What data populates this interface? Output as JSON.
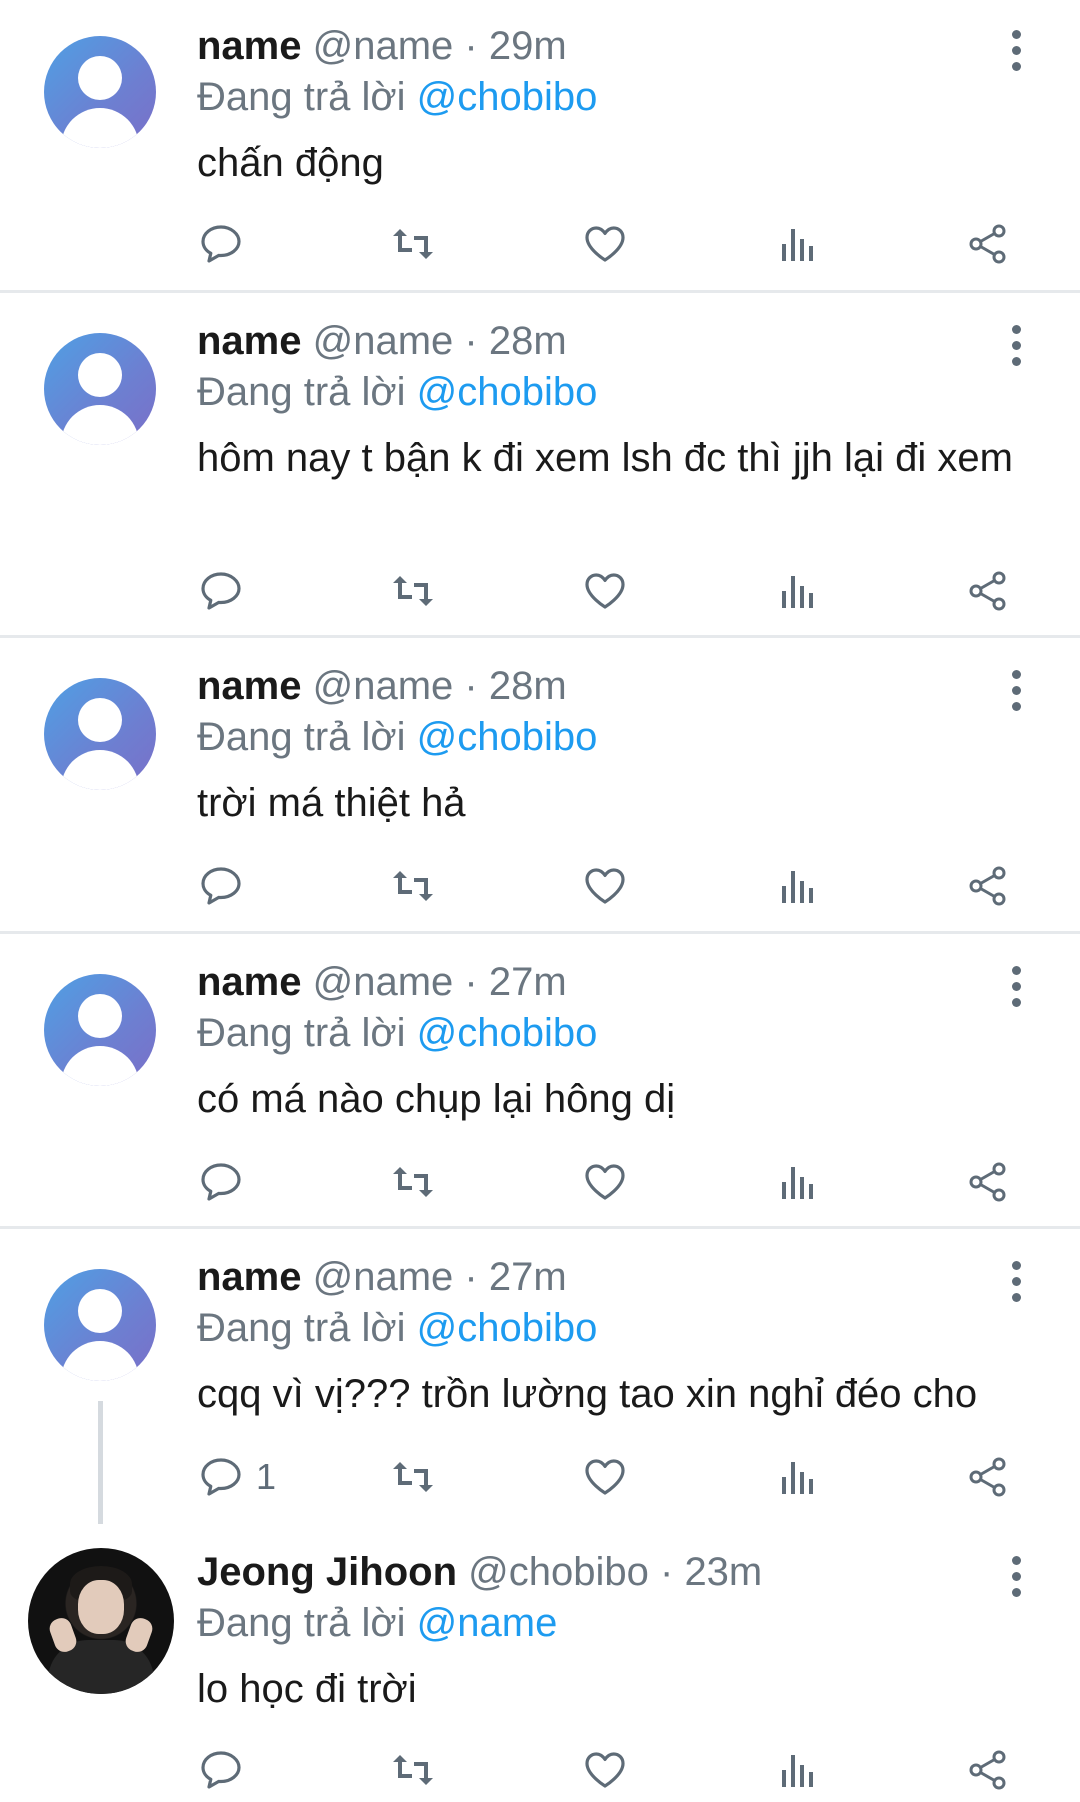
{
  "reply_prefix": "Đang trả lời",
  "dot": "·",
  "tweets": [
    {
      "name": "name",
      "handle": "@name",
      "time": "29m",
      "reply_to": "@chobibo",
      "text": "chấn động",
      "reply_count": ""
    },
    {
      "name": "name",
      "handle": "@name",
      "time": "28m",
      "reply_to": "@chobibo",
      "text": "hôm nay t bận k đi xem lsh đc thì jjh lại đi xem",
      "reply_count": ""
    },
    {
      "name": "name",
      "handle": "@name",
      "time": "28m",
      "reply_to": "@chobibo",
      "text": "trời má thiệt hả",
      "reply_count": ""
    },
    {
      "name": "name",
      "handle": "@name",
      "time": "27m",
      "reply_to": "@chobibo",
      "text": "có má nào chụp lại hông dị",
      "reply_count": ""
    },
    {
      "name": "name",
      "handle": "@name",
      "time": "27m",
      "reply_to": "@chobibo",
      "text": "cqq vì vị??? trồn lường tao xin nghỉ đéo cho",
      "reply_count": "1"
    },
    {
      "name": "Jeong Jihoon",
      "handle": "@chobibo",
      "time": "23m",
      "reply_to": "@name",
      "text": "lo học đi trời",
      "reply_count": ""
    }
  ],
  "icons": {
    "reply": "reply-icon",
    "retweet": "retweet-icon",
    "like": "heart-icon",
    "views": "views-icon",
    "share": "share-icon",
    "more": "more-vertical-icon",
    "avatar": "default-avatar-icon"
  },
  "colors": {
    "mention": "#1d9bf0",
    "muted": "#6b7680",
    "divider": "#e6e9ec"
  }
}
